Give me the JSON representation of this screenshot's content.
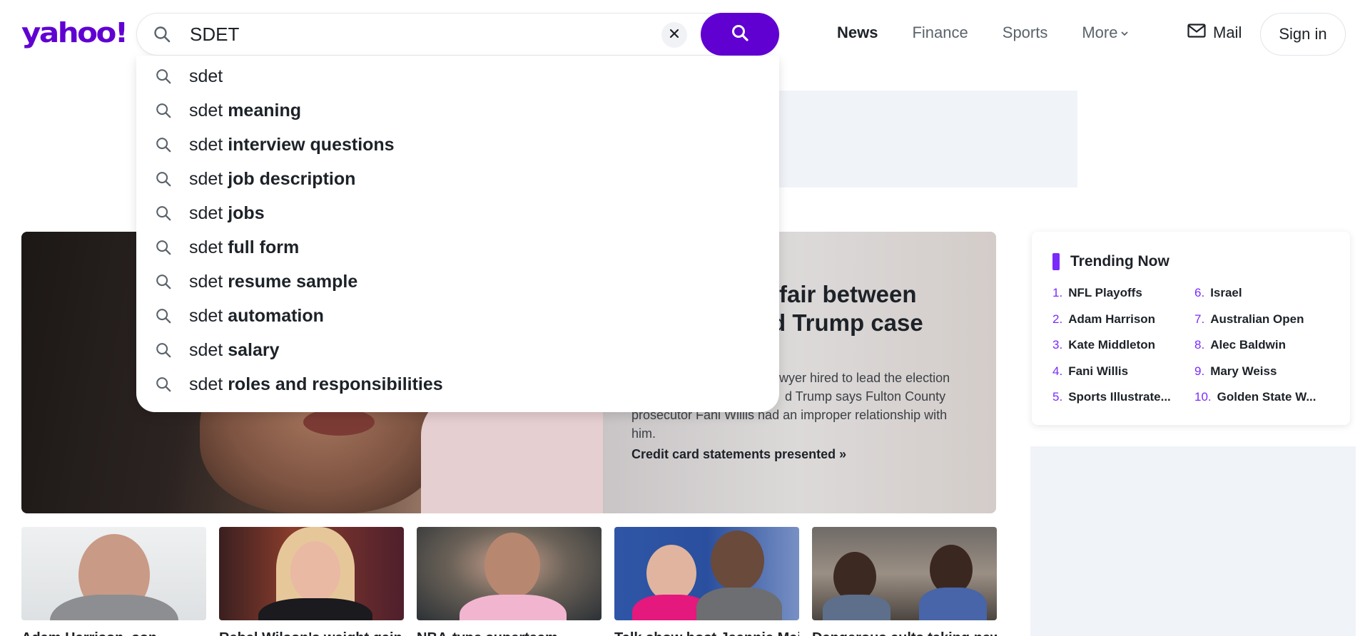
{
  "logo": {
    "text": "yahoo!"
  },
  "search": {
    "value": "SDET",
    "placeholder": ""
  },
  "nav": [
    {
      "label": "News",
      "active": true
    },
    {
      "label": "Finance",
      "active": false
    },
    {
      "label": "Sports",
      "active": false
    },
    {
      "label": "More",
      "active": false
    }
  ],
  "mail_label": "Mail",
  "signin_label": "Sign in",
  "suggestions": [
    {
      "prefix": "sdet",
      "bold": ""
    },
    {
      "prefix": "sdet ",
      "bold": "meaning"
    },
    {
      "prefix": "sdet ",
      "bold": "interview questions"
    },
    {
      "prefix": "sdet ",
      "bold": "job description"
    },
    {
      "prefix": "sdet ",
      "bold": "jobs"
    },
    {
      "prefix": "sdet ",
      "bold": "full form"
    },
    {
      "prefix": "sdet ",
      "bold": "resume sample"
    },
    {
      "prefix": "sdet ",
      "bold": "automation"
    },
    {
      "prefix": "sdet ",
      "bold": "salary"
    },
    {
      "prefix": "sdet ",
      "bold": "roles and responsibilities"
    }
  ],
  "hero": {
    "headline_line1": "ffair between",
    "headline_line2": "d Trump case",
    "summary_line1": "awyer hired to lead the election",
    "summary_line2": "d Trump says Fulton County",
    "summary_line3": "prosecutor Fani Willis had an improper relationship with",
    "summary_line4": "him.",
    "link": "Credit card statements presented  »"
  },
  "thumbnails": [
    {
      "caption": "Adam Harrison, son"
    },
    {
      "caption": "Rebel Wilson's weight gain"
    },
    {
      "caption": "NBA-type superteam"
    },
    {
      "caption": "Talk show host Jeannie Mai"
    },
    {
      "caption": "Dangerous cults taking new"
    }
  ],
  "trending": {
    "title": "Trending Now",
    "items": [
      {
        "num": "1.",
        "label": "NFL Playoffs"
      },
      {
        "num": "2.",
        "label": "Adam Harrison"
      },
      {
        "num": "3.",
        "label": "Kate Middleton"
      },
      {
        "num": "4.",
        "label": "Fani Willis"
      },
      {
        "num": "5.",
        "label": "Sports Illustrate..."
      },
      {
        "num": "6.",
        "label": "Israel"
      },
      {
        "num": "7.",
        "label": "Australian Open"
      },
      {
        "num": "8.",
        "label": "Alec Baldwin"
      },
      {
        "num": "9.",
        "label": "Mary Weiss"
      },
      {
        "num": "10.",
        "label": "Golden State W..."
      }
    ]
  },
  "colors": {
    "brand": "#6001d2",
    "trend_accent": "#7b2bf9",
    "text": "#1d2228"
  }
}
